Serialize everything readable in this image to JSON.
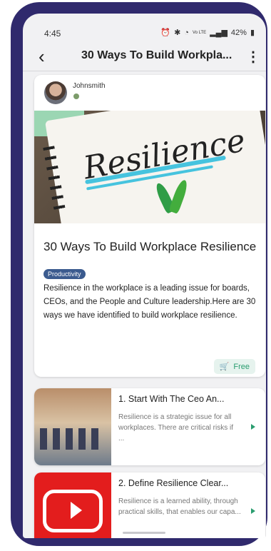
{
  "status": {
    "time": "4:45",
    "icons": [
      "alarm-icon",
      "bluetooth-icon",
      "wifi-icon",
      "signal-icon"
    ],
    "signal_text": "Vo LTE",
    "battery": "42%"
  },
  "appbar": {
    "back_icon": "back-arrow-icon",
    "title": "30 Ways To Build Workpla...",
    "menu_icon": "more-vert-icon"
  },
  "post": {
    "author": "Johnsmith",
    "hero_image_text": "Resilience",
    "title": "30 Ways To Build Workplace Resilience",
    "tag": "Productivity",
    "description": "Resilience in the workplace is a leading issue for boards, CEOs, and the People and Culture leadership.Here are 30 ways we have identified to build workplace resilience.",
    "price_label": "Free",
    "accent": "#2a9d6f"
  },
  "items": [
    {
      "title": "1. Start With The Ceo An...",
      "description": "Resilience is a strategic issue for all workplaces. There are critical risks if ..."
    },
    {
      "title": "2. Define Resilience Clear...",
      "description": "Resilience is a learned ability, through practical skills, that enables our capa..."
    }
  ]
}
